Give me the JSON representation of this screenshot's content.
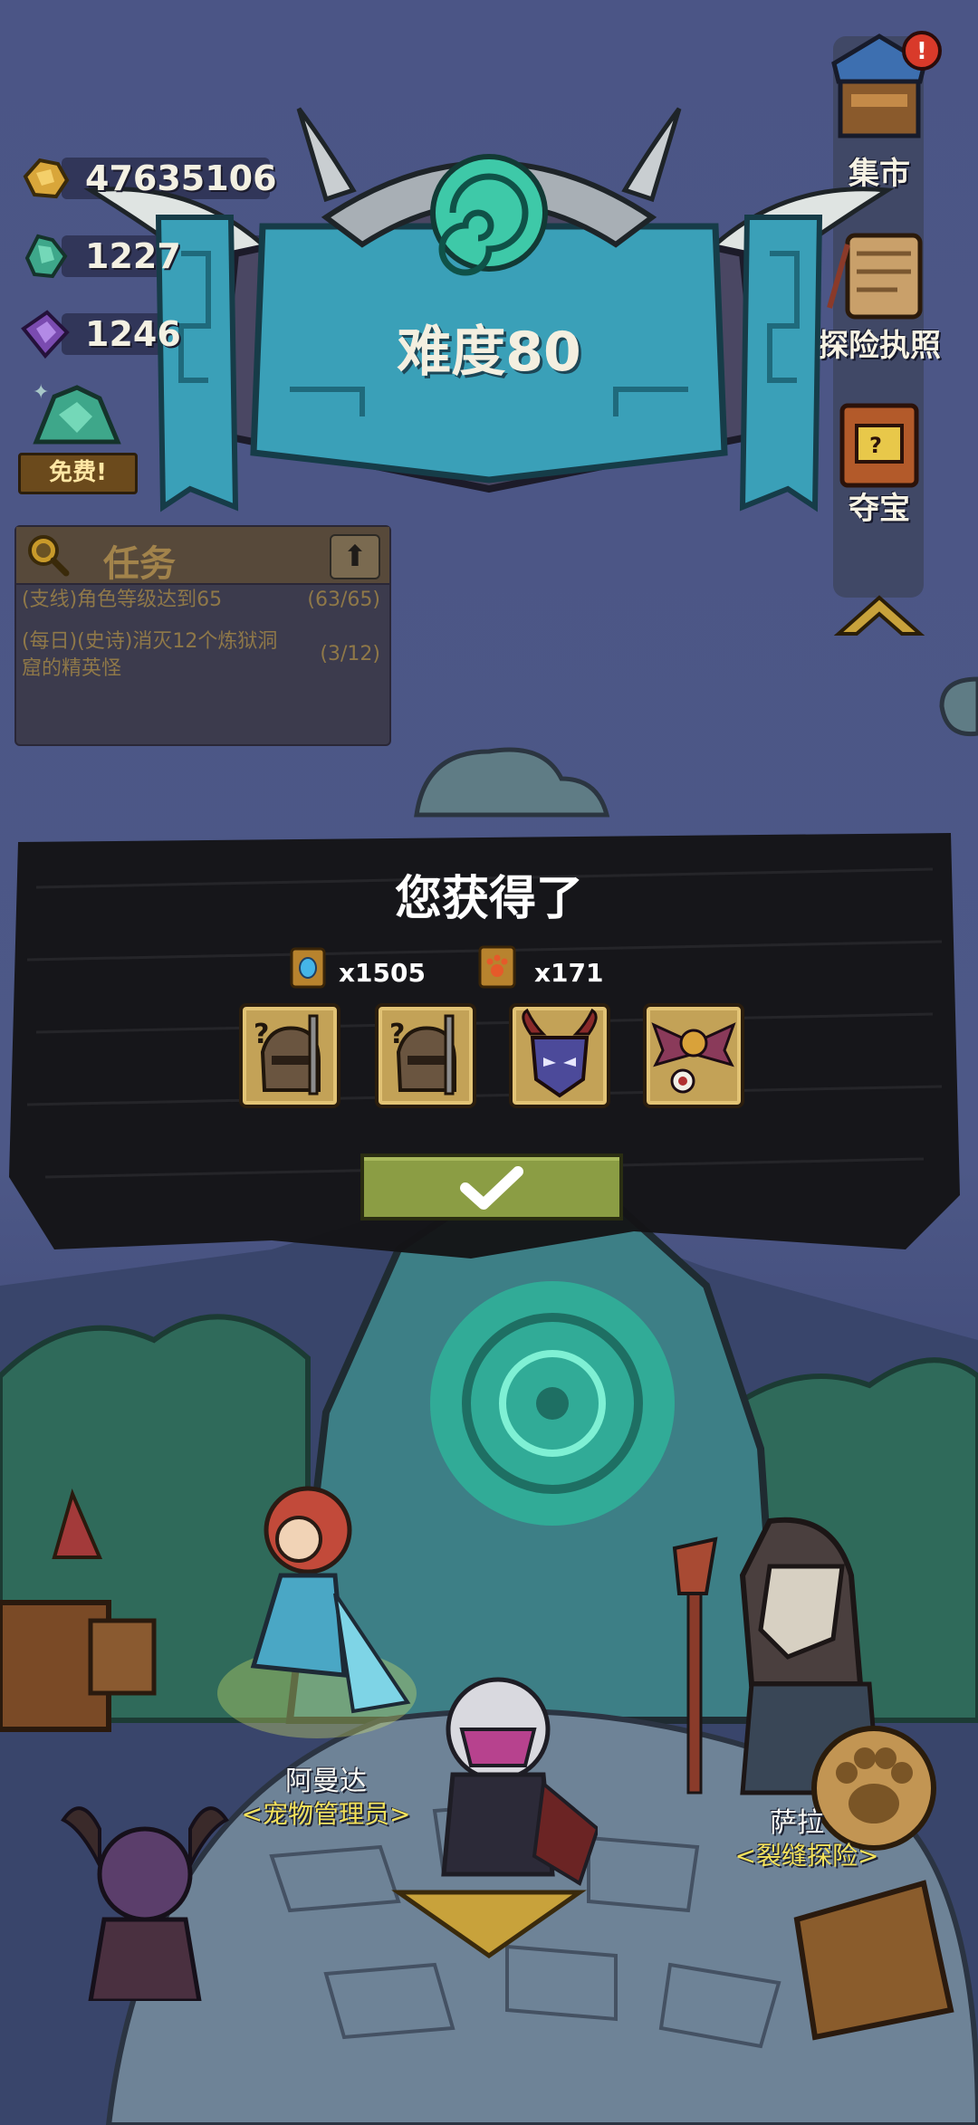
{
  "currencies": [
    {
      "icon": "gold-ore-icon",
      "value": "47635106"
    },
    {
      "icon": "green-crystal-icon",
      "value": "1227"
    },
    {
      "icon": "purple-gem-icon",
      "value": "1246"
    }
  ],
  "free_offer": {
    "label": "免费!"
  },
  "difficulty": {
    "label": "难度80"
  },
  "quest_panel": {
    "title": "任务",
    "items": [
      {
        "text": "(支线)角色等级达到65",
        "progress": "(63/65)"
      },
      {
        "text": "(每日)(史诗)消灭12个炼狱洞窟的精英怪",
        "progress": "(3/12)"
      }
    ]
  },
  "side_menu": [
    {
      "label": "集市",
      "icon": "market-stall-icon",
      "alert": "!"
    },
    {
      "label": "探险执照",
      "icon": "scroll-license-icon"
    },
    {
      "label": "夺宝",
      "icon": "treasure-box-icon"
    }
  ],
  "reward_dialog": {
    "title": "您获得了",
    "resources": [
      {
        "icon": "blue-gem-book-icon",
        "count": "x1505"
      },
      {
        "icon": "paw-book-icon",
        "count": "x171"
      }
    ],
    "items": [
      {
        "icon": "knight-helmet-sword-icon"
      },
      {
        "icon": "knight-helmet-sword-icon"
      },
      {
        "icon": "horned-demon-mask-icon"
      },
      {
        "icon": "bat-eyeball-icon"
      }
    ],
    "confirm_icon": "checkmark-icon"
  },
  "npcs": [
    {
      "name": "阿曼达",
      "role": "<宠物管理员>"
    },
    {
      "name": "萨拉",
      "role": "<裂缝探险>"
    }
  ],
  "colors": {
    "sky": "#4b5586",
    "banner_teal": "#3aa0b8",
    "portal_green": "#3ec9a8",
    "reward_bg": "#141416",
    "confirm_green": "#8b9d44",
    "npc_role_yellow": "#f3e15a"
  }
}
